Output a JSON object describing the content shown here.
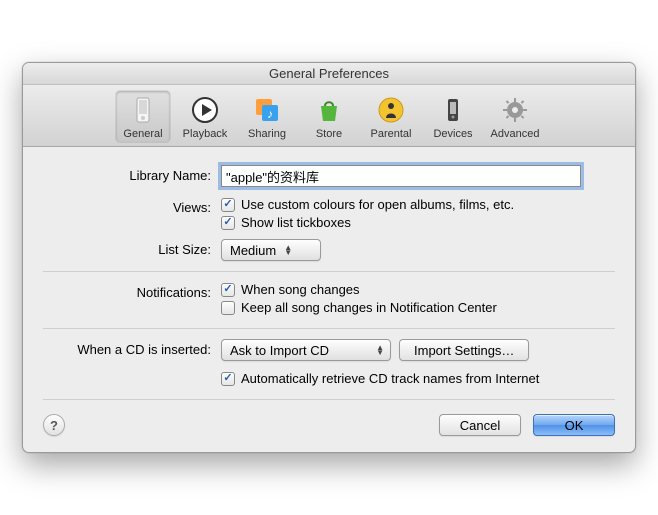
{
  "window": {
    "title": "General Preferences"
  },
  "toolbar": {
    "items": [
      {
        "label": "General",
        "selected": true
      },
      {
        "label": "Playback",
        "selected": false
      },
      {
        "label": "Sharing",
        "selected": false
      },
      {
        "label": "Store",
        "selected": false
      },
      {
        "label": "Parental",
        "selected": false
      },
      {
        "label": "Devices",
        "selected": false
      },
      {
        "label": "Advanced",
        "selected": false
      }
    ]
  },
  "labels": {
    "libraryName": "Library Name:",
    "views": "Views:",
    "listSize": "List Size:",
    "notifications": "Notifications:",
    "cdInserted": "When a CD is inserted:"
  },
  "libraryName": {
    "value": "\"apple\"的资料库"
  },
  "views": {
    "customColoursChecked": true,
    "customColoursLabel": "Use custom colours for open albums, films, etc.",
    "showTickboxesChecked": true,
    "showTickboxesLabel": "Show list tickboxes"
  },
  "listSize": {
    "value": "Medium"
  },
  "notifications": {
    "songChangesChecked": true,
    "songChangesLabel": "When song changes",
    "keepInCenterChecked": false,
    "keepInCenterLabel": "Keep all song changes in Notification Center"
  },
  "cd": {
    "action": "Ask to Import CD",
    "importSettingsLabel": "Import Settings…",
    "autoRetrieveChecked": true,
    "autoRetrieveLabel": "Automatically retrieve CD track names from Internet"
  },
  "buttons": {
    "cancel": "Cancel",
    "ok": "OK",
    "help": "?"
  }
}
